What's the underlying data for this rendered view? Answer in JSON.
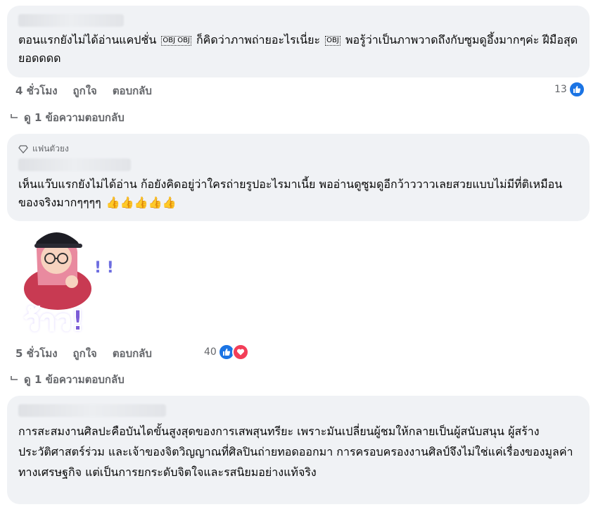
{
  "comments": [
    {
      "text_part1": "ตอนแรกยังไม่ได้อ่านแคปชั่น",
      "emoji1": "OBJ OBJ",
      "text_part2": "ก็คิดว่าภาพถ่ายอะไรเนี่ยะ",
      "emoji2": "OBJ",
      "text_part3": "พอรู้ว่าเป็นภาพวาดถึงกับซูมดูอึ้งมากๆค่ะ ฝีมือสุดยอดดดด",
      "time": "4 ชั่วโมง",
      "like_label": "ถูกใจ",
      "reply_label": "ตอบกลับ",
      "reaction_count": "13",
      "replies_label": "ดู 1 ข้อความตอบกลับ"
    },
    {
      "badge": "แฟนตัวยง",
      "text": "เห็นแว๊บแรกยังไม่ได้อ่าน ก้อยังคิดอยู่ว่าใครถ่ายรูปอะไรมาเนี้ย พออ่านดูซูมดูอีกว้าววาวเลยสวยแบบไม่มีที่ติเหมือนของจริงมากๆๆๆๆ",
      "thumbs": "👍👍👍👍👍",
      "sticker_text": "ว้าว!",
      "time": "5 ชั่วโมง",
      "like_label": "ถูกใจ",
      "reply_label": "ตอบกลับ",
      "reaction_count": "40",
      "replies_label": "ดู 1 ข้อความตอบกลับ"
    },
    {
      "text": "การสะสมงานศิลปะคือบันไดขั้นสูงสุดของการเสพสุนทรียะ เพราะมันเปลี่ยนผู้ชมให้กลายเป็นผู้สนับสนุน ผู้สร้างประวัติศาสตร์ร่วม และเจ้าของจิตวิญญาณที่ศิลปินถ่ายทอดออกมา การครอบครองงานศิลป์จึงไม่ใช่แค่เรื่องของมูลค่าทางเศรษฐกิจ แต่เป็นการยกระดับจิตใจและรสนิยมอย่างแท้จริง"
    }
  ],
  "colors": {
    "like": "#1b74e4",
    "love": "#f33e58",
    "bubble": "#f0f2f5",
    "meta": "#65676b"
  }
}
